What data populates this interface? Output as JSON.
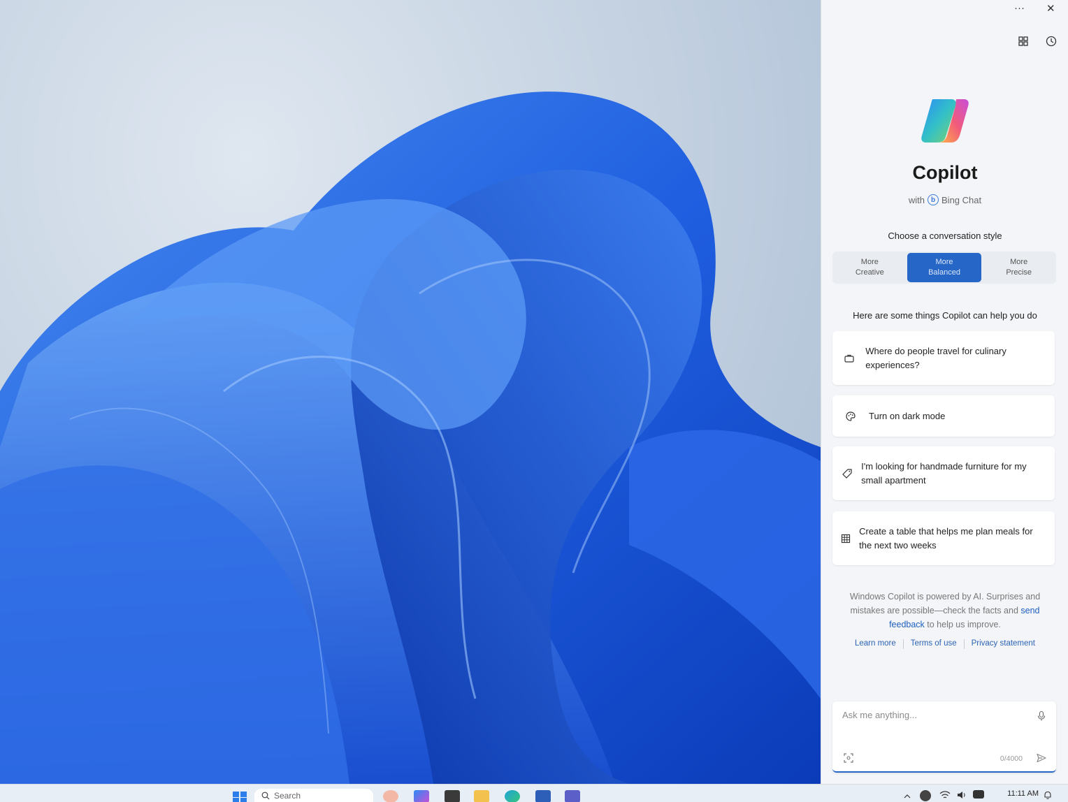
{
  "window": {
    "more_label": "···",
    "close_label": "✕"
  },
  "header": {
    "title": "Copilot",
    "with_label": "with",
    "bing_label": "Bing Chat"
  },
  "conversation_style": {
    "label": "Choose a conversation style",
    "options": [
      {
        "label": "More\nCreative",
        "selected": false
      },
      {
        "label": "More\nBalanced",
        "selected": true
      },
      {
        "label": "More\nPrecise",
        "selected": false
      }
    ]
  },
  "suggestions": {
    "label": "Here are some things Copilot can help you do",
    "items": [
      {
        "icon": "briefcase-icon",
        "text": "Where do people travel for culinary experiences?"
      },
      {
        "icon": "palette-icon",
        "text": "Turn on dark mode"
      },
      {
        "icon": "tag-icon",
        "text": "I'm looking for handmade furniture for my small apartment"
      },
      {
        "icon": "table-icon",
        "text": "Create a table that helps me plan meals for the next two weeks"
      }
    ]
  },
  "disclaimer": {
    "text_before": "Windows Copilot is powered by AI. Surprises and mistakes are possible—check the facts and ",
    "link": "send feedback",
    "text_after": " to help us improve."
  },
  "footer_links": [
    "Learn more",
    "Terms of use",
    "Privacy statement"
  ],
  "composer": {
    "placeholder": "Ask me anything...",
    "counter": "0/4000"
  },
  "taskbar": {
    "search_label": "Search",
    "time": "11:11 AM"
  },
  "colors": {
    "accent": "#2566c6",
    "pane_bg": "#f3f5f8"
  }
}
